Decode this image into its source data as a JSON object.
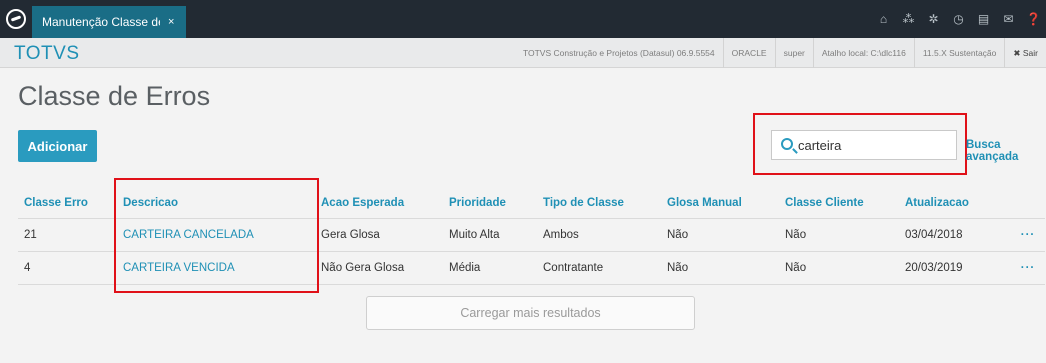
{
  "topbar": {
    "tab_title": "Manutenção Classe de",
    "tab_close": "×",
    "icons": [
      {
        "name": "home-icon",
        "glyph": "⌂"
      },
      {
        "name": "sitemap-icon",
        "glyph": "⁂"
      },
      {
        "name": "gear-icon",
        "glyph": "✲"
      },
      {
        "name": "clock-icon",
        "glyph": "◷"
      },
      {
        "name": "document-icon",
        "glyph": "▤"
      },
      {
        "name": "mail-icon",
        "glyph": "✉"
      },
      {
        "name": "help-icon",
        "glyph": "❓"
      }
    ]
  },
  "subbar": {
    "brand": "TOTVS",
    "company": "TOTVS Construção e Projetos (Datasul) 06.9.5554",
    "database": "ORACLE",
    "user": "super",
    "shortcut": "Atalho local: C:\\dlc116",
    "version": "11.5.X Sustentação",
    "exit": "✖ Sair"
  },
  "page": {
    "title": "Classe de Erros",
    "add_label": "Adicionar",
    "search_value": "carteira",
    "advanced_search": "Busca avançada",
    "load_more": "Carregar mais resultados"
  },
  "table": {
    "headers": [
      "Classe Erro",
      "Descricao",
      "Acao Esperada",
      "Prioridade",
      "Tipo de Classe",
      "Glosa Manual",
      "Classe Cliente",
      "Atualizacao",
      ""
    ],
    "rows": [
      [
        "21",
        "CARTEIRA CANCELADA",
        "Gera Glosa",
        "Muito Alta",
        "Ambos",
        "Não",
        "Não",
        "03/04/2018",
        "···"
      ],
      [
        "4",
        "CARTEIRA VENCIDA",
        "Não Gera Glosa",
        "Média",
        "Contratante",
        "Não",
        "Não",
        "20/03/2019",
        "···"
      ]
    ]
  },
  "colors": {
    "accent": "#2a9bbf",
    "highlight": "#e01018",
    "topbar": "#222a33"
  }
}
